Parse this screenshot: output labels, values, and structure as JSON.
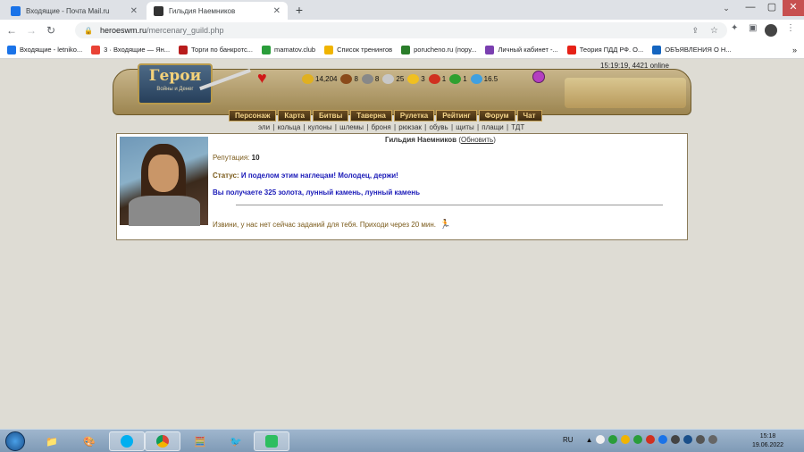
{
  "browser": {
    "tabs": [
      {
        "title": "Входящие - Почта Mail.ru",
        "icon_color": "#1a73e8"
      },
      {
        "title": "Гильдия Наемников",
        "icon_color": "#333333"
      }
    ],
    "new_tab": "+",
    "tab_search": "⌄",
    "window": {
      "minimize": "—",
      "maximize": "▢",
      "close": "✕"
    },
    "url": {
      "host": "heroeswm.ru",
      "path": "/mercenary_guild.php"
    },
    "bookmarks": [
      {
        "label": "Входящие - letniko...",
        "color": "#1a73e8"
      },
      {
        "label": "3 · Входящие — Ян...",
        "color": "#e94235"
      },
      {
        "label": "Торги по банкротс...",
        "color": "#b81c1c"
      },
      {
        "label": "mamatov.club",
        "color": "#2a9d3a"
      },
      {
        "label": "Список тренингов",
        "color": "#f0b400"
      },
      {
        "label": "porucheno.ru (пору...",
        "color": "#2a7d2a"
      },
      {
        "label": "Личный кабинет -...",
        "color": "#7a3fb0"
      },
      {
        "label": "Теория ПДД РФ. О...",
        "color": "#e62117"
      },
      {
        "label": "ОБЪЯВЛЕНИЯ О Н...",
        "color": "#1565c0"
      }
    ],
    "bookmarks_more": "»"
  },
  "game": {
    "online_text": "15:19:19, 4421 online",
    "logo": {
      "title": "Герои",
      "subtitle": "Войны и Денег"
    },
    "resources": [
      {
        "value": "14,204",
        "color": "#e0b020"
      },
      {
        "value": "8",
        "color": "#8a4a1a"
      },
      {
        "value": "8",
        "color": "#888888"
      },
      {
        "value": "25",
        "color": "#c8c8c8"
      },
      {
        "value": "3",
        "color": "#f0c020"
      },
      {
        "value": "1",
        "color": "#d03020"
      },
      {
        "value": "1",
        "color": "#30a030"
      },
      {
        "value": "16.5",
        "color": "#40a0e0"
      }
    ],
    "menu": [
      "Персонаж",
      "Карта",
      "Битвы",
      "Таверна",
      "Рулетка",
      "Рейтинг",
      "Форум",
      "Чат"
    ],
    "submenu": [
      "эли",
      "кольца",
      "кулоны",
      "шлемы",
      "броня",
      "рюкзак",
      "обувь",
      "щиты",
      "плащи",
      "ТДТ"
    ]
  },
  "guild": {
    "title": "Гильдия Наемников",
    "refresh_label": "Обновить",
    "reputation_label": "Репутация:",
    "reputation_value": "10",
    "status_label": "Статус:",
    "status_value": "И поделом этим наглецам! Молодец, держи!",
    "reward_text": "Вы получаете 325 золота, лунный камень, лунный камень",
    "no_tasks_text": "Извини, у нас нет сейчас заданий для тебя. Приходи через 20 мин."
  },
  "taskbar": {
    "lang": "RU",
    "time": "15:18",
    "date": "19.06.2022"
  }
}
